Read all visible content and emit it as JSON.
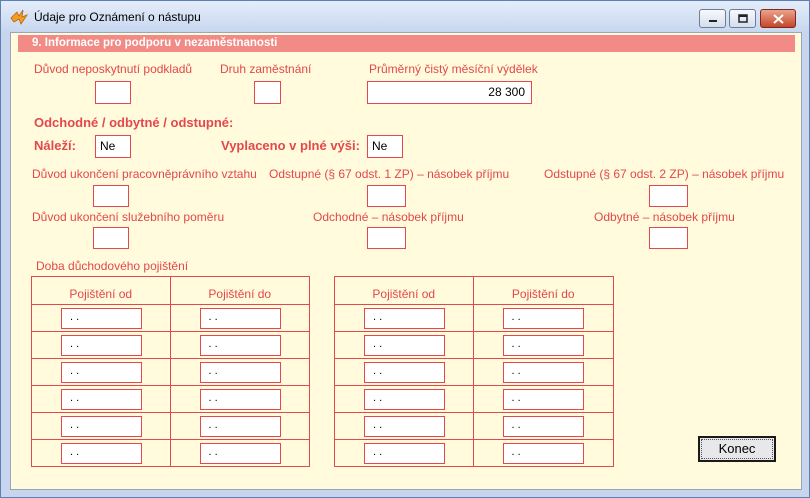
{
  "window": {
    "title": "Údaje pro Oznámení o nástupu",
    "minimize_label": "Minimize",
    "maximize_label": "Maximize",
    "close_label": "Close"
  },
  "section": {
    "header": "9. Informace pro podporu v nezaměstnanosti"
  },
  "fields": {
    "duvod_neposkytnuti_label": "Důvod neposkytnutí podkladů",
    "duvod_neposkytnuti_value": "",
    "druh_zamestnani_label": "Druh zaměstnání",
    "druh_zamestnani_value": "",
    "prumerny_vydelek_label": "Průměrný čistý měsíční výdělek",
    "prumerny_vydelek_value": "28 300"
  },
  "severance": {
    "heading": "Odchodné / odbytné / odstupné:",
    "nalezi_label": "Náleží:",
    "nalezi_value": "Ne",
    "vyplaceno_label": "Vyplaceno v plné výši:",
    "vyplaceno_value": "Ne",
    "duvod_ukonceni_pracovni_label": "Důvod ukončení pracovněprávního vztahu",
    "duvod_ukonceni_pracovni_value": "",
    "odstupne_1_label": "Odstupné (§ 67 odst. 1 ZP) – násobek příjmu",
    "odstupne_1_value": "",
    "odstupne_2_label": "Odstupné (§ 67 odst. 2 ZP) – násobek příjmu",
    "odstupne_2_value": "",
    "duvod_ukonceni_sluzebni_label": "Důvod ukončení služebního poměru",
    "duvod_ukonceni_sluzebni_value": "",
    "odchodne_label": "Odchodné – násobek příjmu",
    "odchodne_value": "",
    "odbytne_label": "Odbytné – násobek příjmu",
    "odbytne_value": ""
  },
  "pension": {
    "heading": "Doba důchodového pojištění",
    "col_from": "Pojištění od",
    "col_to": "Pojištění do",
    "left_rows": [
      {
        "from": ". .",
        "to": ". ."
      },
      {
        "from": ". .",
        "to": ". ."
      },
      {
        "from": ". .",
        "to": ". ."
      },
      {
        "from": ". .",
        "to": ". ."
      },
      {
        "from": ". .",
        "to": ". ."
      },
      {
        "from": ". .",
        "to": ". ."
      }
    ],
    "right_rows": [
      {
        "from": ". .",
        "to": ". ."
      },
      {
        "from": ". .",
        "to": ". ."
      },
      {
        "from": ". .",
        "to": ". ."
      },
      {
        "from": ". .",
        "to": ". ."
      },
      {
        "from": ". .",
        "to": ". ."
      },
      {
        "from": ". .",
        "to": ". ."
      }
    ]
  },
  "buttons": {
    "konec": "Konec"
  },
  "colors": {
    "accent": "#e4474c",
    "header_bg": "#f28b86",
    "panel_bg": "#fffbdc"
  }
}
